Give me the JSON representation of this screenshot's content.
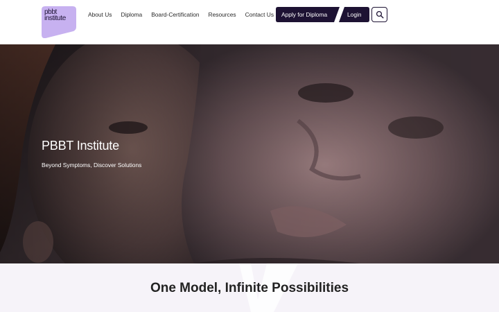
{
  "brand": {
    "logo_lines": [
      "pbbt",
      "institute"
    ],
    "accent": "#c7b1f0",
    "dark": "#1d1233"
  },
  "nav": {
    "items": [
      {
        "label": "About Us"
      },
      {
        "label": "Diploma"
      },
      {
        "label": "Board-Certification"
      },
      {
        "label": "Resources"
      },
      {
        "label": "Contact Us"
      }
    ]
  },
  "actions": {
    "apply_label": "Apply for Diploma",
    "login_label": "Login",
    "search_icon": "search-icon"
  },
  "hero": {
    "title": "PBBT Institute",
    "subtitle": "Beyond Symptoms, Discover Solutions"
  },
  "section": {
    "title": "One Model, Infinite Possibilities"
  }
}
